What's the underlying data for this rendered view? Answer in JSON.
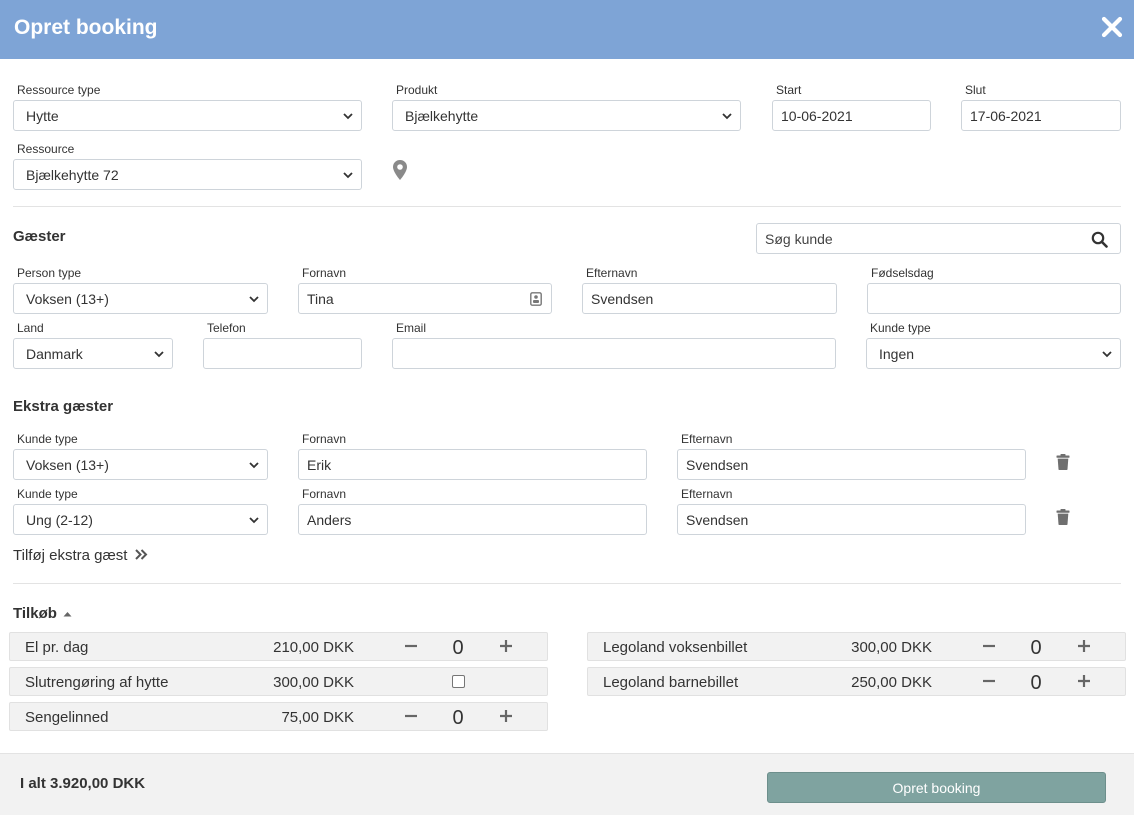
{
  "header": {
    "title": "Opret booking"
  },
  "booking": {
    "resource_type_label": "Ressource type",
    "resource_type_value": "Hytte",
    "product_label": "Produkt",
    "product_value": "Bjælkehytte",
    "start_label": "Start",
    "start_value": "10-06-2021",
    "end_label": "Slut",
    "end_value": "17-06-2021",
    "resource_label": "Ressource",
    "resource_value": "Bjælkehytte 72"
  },
  "guests": {
    "heading": "Gæster",
    "search_placeholder": "Søg kunde",
    "person_type_label": "Person type",
    "person_type_value": "Voksen (13+)",
    "firstname_label": "Fornavn",
    "firstname_value": "Tina",
    "lastname_label": "Efternavn",
    "lastname_value": "Svendsen",
    "birthday_label": "Fødselsdag",
    "birthday_value": "",
    "country_label": "Land",
    "country_value": "Danmark",
    "phone_label": "Telefon",
    "phone_value": "",
    "email_label": "Email",
    "email_value": "",
    "customer_type_label": "Kunde type",
    "customer_type_value": "Ingen"
  },
  "extra_guests": {
    "heading": "Ekstra gæster",
    "rows": [
      {
        "type_label": "Kunde type",
        "type_value": "Voksen (13+)",
        "firstname_label": "Fornavn",
        "firstname_value": "Erik",
        "lastname_label": "Efternavn",
        "lastname_value": "Svendsen"
      },
      {
        "type_label": "Kunde type",
        "type_value": "Ung (2-12)",
        "firstname_label": "Fornavn",
        "firstname_value": "Anders",
        "lastname_label": "Efternavn",
        "lastname_value": "Svendsen"
      }
    ],
    "add_link": "Tilføj ekstra gæst"
  },
  "addons": {
    "heading": "Tilkøb",
    "left": [
      {
        "name": "El pr. dag",
        "price": "210,00 DKK",
        "control": "stepper",
        "qty": "0"
      },
      {
        "name": "Slutrengøring af hytte",
        "price": "300,00 DKK",
        "control": "checkbox",
        "checked": false
      },
      {
        "name": "Sengelinned",
        "price": "75,00 DKK",
        "control": "stepper",
        "qty": "0"
      }
    ],
    "right": [
      {
        "name": "Legoland voksenbillet",
        "price": "300,00 DKK",
        "control": "stepper",
        "qty": "0"
      },
      {
        "name": "Legoland barnebillet",
        "price": "250,00 DKK",
        "control": "stepper",
        "qty": "0"
      }
    ]
  },
  "footer": {
    "total": "I alt 3.920,00 DKK",
    "submit_label": "Opret booking"
  },
  "icons": {
    "close": "close-icon",
    "location": "map-marker-icon",
    "search": "search-icon",
    "contact": "contact-card-icon",
    "chevron": "chevron-down-icon",
    "trash": "trash-icon",
    "double_chevron": "double-chevron-right-icon",
    "caret_up": "caret-up-icon",
    "minus": "minus-icon",
    "plus": "plus-icon"
  },
  "colors": {
    "header_bg": "#7ea4d6",
    "button_bg": "#7fa3a0",
    "footer_bg": "#f2f2f2"
  }
}
